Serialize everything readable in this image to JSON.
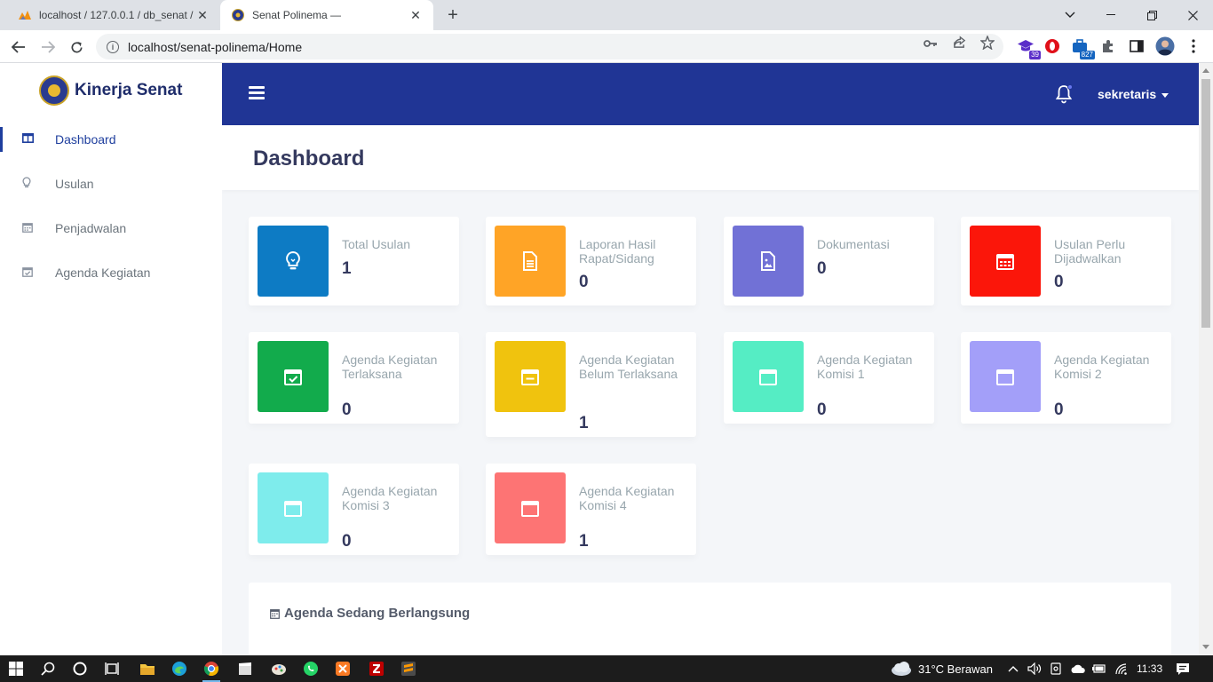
{
  "browser": {
    "tabs": [
      {
        "title": "localhost / 127.0.0.1 / db_senat / …",
        "icon": "phpmyadmin-icon",
        "active": false
      },
      {
        "title": "Senat Polinema —",
        "icon": "polinema-logo-icon",
        "active": true
      }
    ],
    "url": "localhost/senat-polinema/Home",
    "extensions": [
      {
        "name": "mortarboard-extension-icon",
        "badge": "39",
        "color": "#5b2fc9"
      },
      {
        "name": "opera-extension-icon",
        "badge": "",
        "color": "#e0101a"
      },
      {
        "name": "briefcase-extension-icon",
        "badge": "827",
        "color": "#1565c0"
      }
    ]
  },
  "sidebar": {
    "brand": "Kinerja Senat",
    "items": [
      {
        "label": "Dashboard",
        "icon": "columns-icon",
        "active": true
      },
      {
        "label": "Usulan",
        "icon": "lightbulb-icon",
        "active": false
      },
      {
        "label": "Penjadwalan",
        "icon": "calendar-icon",
        "active": false
      },
      {
        "label": "Agenda Kegiatan",
        "icon": "calendar-check-icon",
        "active": false
      }
    ]
  },
  "navbar": {
    "user": "sekretaris"
  },
  "page": {
    "title": "Dashboard"
  },
  "stats": [
    {
      "label": "Total Usulan",
      "value": "1",
      "color": "#0d7bc4",
      "icon": "lightbulb-icon"
    },
    {
      "label": "Laporan Hasil Rapat/Sidang",
      "value": "0",
      "color": "#ffa426",
      "icon": "file-icon"
    },
    {
      "label": "Dokumentasi",
      "value": "0",
      "color": "#7171d6",
      "icon": "image-file-icon"
    },
    {
      "label": "Usulan Perlu Dijadwalkan",
      "value": "0",
      "color": "#fb160a",
      "icon": "calendar-icon"
    },
    {
      "label": "Agenda Kegiatan Terlaksana",
      "value": "0",
      "color": "#12ab4c",
      "icon": "calendar-check-icon"
    },
    {
      "label": "Agenda Kegiatan Belum Terlaksana",
      "value": "1",
      "color": "#f0c30e",
      "icon": "calendar-minus-icon"
    },
    {
      "label": "Agenda Kegiatan Komisi 1",
      "value": "0",
      "color": "#55edc4",
      "icon": "calendar-icon"
    },
    {
      "label": "Agenda Kegiatan Komisi 2",
      "value": "0",
      "color": "#a39ff9",
      "icon": "calendar-icon"
    },
    {
      "label": "Agenda Kegiatan Komisi 3",
      "value": "0",
      "color": "#7eecec",
      "icon": "calendar-icon"
    },
    {
      "label": "Agenda Kegiatan Komisi 4",
      "value": "1",
      "color": "#fd7474",
      "icon": "calendar-icon"
    }
  ],
  "agenda": {
    "title": "Agenda Sedang Berlangsung"
  },
  "taskbar": {
    "weather": "31°C  Berawan",
    "time": "11:33"
  }
}
